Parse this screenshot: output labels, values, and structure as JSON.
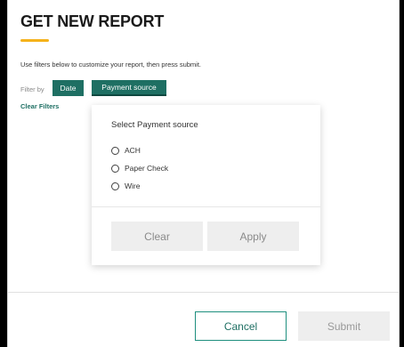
{
  "header": {
    "title": "GET NEW REPORT",
    "accent_color": "#f5b21b"
  },
  "instructions": "Use filters below to customize your report, then press submit.",
  "filters": {
    "label": "Filter by",
    "buttons": [
      {
        "label": "Date"
      },
      {
        "label": "Payment source",
        "active": true
      }
    ],
    "clear_label": "Clear Filters",
    "button_color": "#1e6f63"
  },
  "dropdown": {
    "title": "Select Payment source",
    "options": [
      {
        "label": "ACH",
        "selected": false
      },
      {
        "label": "Paper Check",
        "selected": false
      },
      {
        "label": "Wire",
        "selected": false
      }
    ],
    "clear_label": "Clear",
    "apply_label": "Apply"
  },
  "footer": {
    "cancel_label": "Cancel",
    "submit_label": "Submit"
  }
}
